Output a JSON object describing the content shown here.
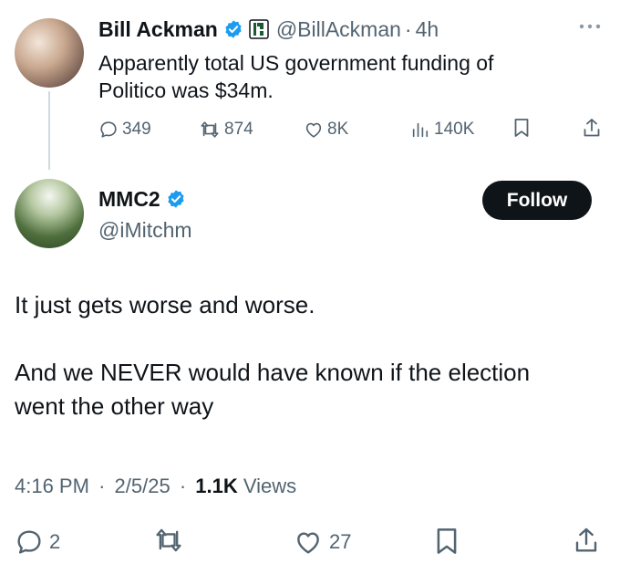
{
  "quoted_tweet": {
    "author_name": "Bill Ackman",
    "handle": "@BillAckman",
    "separator": "·",
    "time": "4h",
    "text_line1": "Apparently total US government funding of",
    "text_line2": "Politico was $34m.",
    "replies": "349",
    "reposts": "874",
    "likes": "8K",
    "views": "140K"
  },
  "main_tweet": {
    "author_name": "MMC2",
    "handle": "@iMitchm",
    "follow_label": "Follow",
    "paragraph1": "It just gets worse and worse.",
    "paragraph2_line1": "And we NEVER would have known if the election",
    "paragraph2_line2": "went the other way",
    "time": "4:16 PM",
    "date": "2/5/25",
    "separator": "·",
    "views_count": "1.1K",
    "views_label": "Views",
    "replies": "2",
    "likes": "27"
  },
  "colors": {
    "verified_blue": "#1d9bf0",
    "text_primary": "#0f1419",
    "text_secondary": "#536471",
    "thread_line": "#cfd9de"
  },
  "icons": [
    "verified-badge-icon",
    "affiliate-badge-icon",
    "more-icon",
    "reply-icon",
    "repost-icon",
    "like-icon",
    "views-icon",
    "bookmark-icon",
    "share-icon"
  ]
}
